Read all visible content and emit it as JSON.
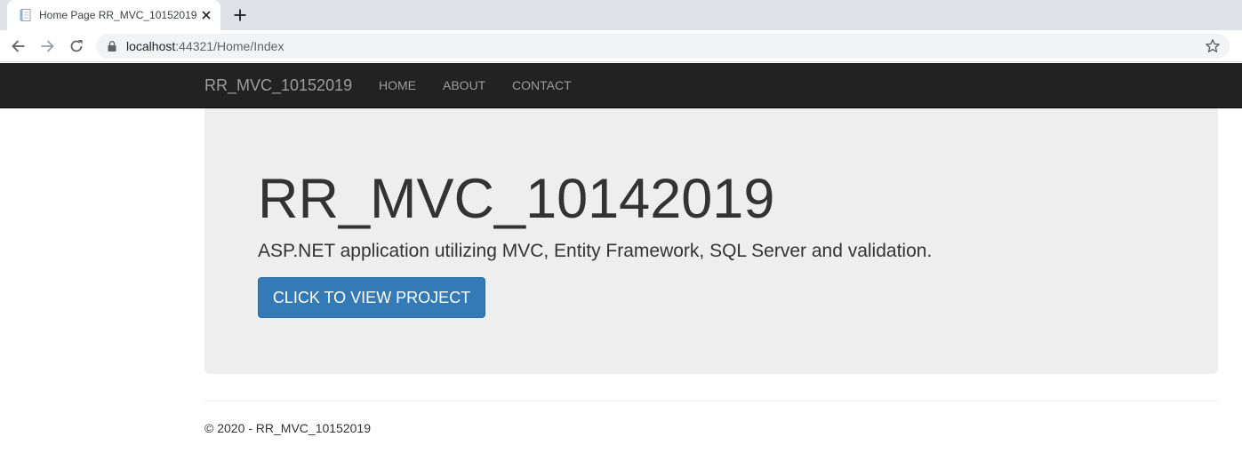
{
  "browser": {
    "tab": {
      "title": "Home Page RR_MVC_10152019",
      "favicon": "page-icon"
    },
    "new_tab_icon": "plus-icon",
    "address": {
      "host": "localhost",
      "rest": ":44321/Home/Index",
      "security_icon": "lock-icon",
      "bookmark_icon": "star-icon"
    },
    "nav_icons": [
      "back-arrow-icon",
      "forward-arrow-icon",
      "reload-icon"
    ]
  },
  "site": {
    "navbar": {
      "brand": "RR_MVC_10152019",
      "links": [
        {
          "label": "HOME"
        },
        {
          "label": "ABOUT"
        },
        {
          "label": "CONTACT"
        }
      ]
    },
    "jumbotron": {
      "title": "RR_MVC_10142019",
      "lead": "ASP.NET application utilizing MVC, Entity Framework, SQL Server and validation.",
      "button_label": "CLICK TO VIEW PROJECT"
    },
    "footer": {
      "text": "© 2020 - RR_MVC_10152019"
    }
  },
  "colors": {
    "navbar_bg": "#222222",
    "jumbotron_bg": "#eeeeee",
    "button_bg": "#337ab7",
    "tabstrip_bg": "#dee1e6",
    "omnibox_bg": "#f1f3f4"
  }
}
